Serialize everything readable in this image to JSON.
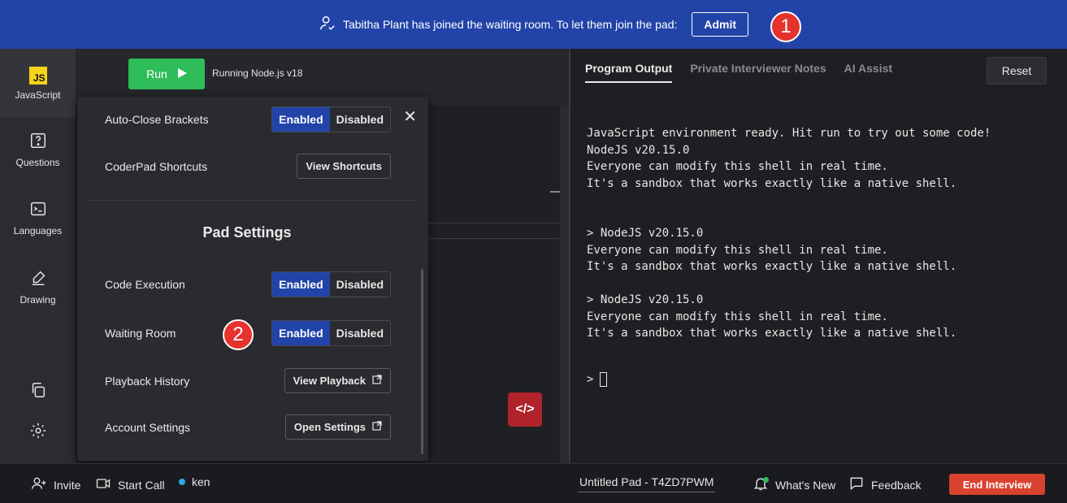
{
  "banner": {
    "message": "Tabitha Plant has joined the waiting room. To let them join the pad:",
    "admit_label": "Admit",
    "marker_1": "1"
  },
  "sidebar": {
    "items": [
      {
        "label": "JavaScript",
        "badge": "JS"
      },
      {
        "label": "Questions"
      },
      {
        "label": "Languages"
      },
      {
        "label": "Drawing"
      }
    ]
  },
  "editor": {
    "run_label": "Run",
    "run_status": "Running Node.js v18",
    "code_icon": "</>"
  },
  "settings": {
    "rows": [
      {
        "label": "Auto-Close Brackets",
        "on": "Enabled",
        "off": "Disabled"
      },
      {
        "label": "CoderPad Shortcuts",
        "button": "View Shortcuts"
      },
      {
        "label": "Code Execution",
        "on": "Enabled",
        "off": "Disabled"
      },
      {
        "label": "Waiting Room",
        "on": "Enabled",
        "off": "Disabled"
      },
      {
        "label": "Playback History",
        "button": "View Playback"
      },
      {
        "label": "Account Settings",
        "button": "Open Settings"
      }
    ],
    "section_title": "Pad Settings",
    "marker_2": "2",
    "close_glyph": "✕"
  },
  "output": {
    "tabs": [
      "Program Output",
      "Private Interviewer Notes",
      "AI Assist"
    ],
    "reset_label": "Reset",
    "console_text": "JavaScript environment ready. Hit run to try out some code!\nNodeJS v20.15.0\nEveryone can modify this shell in real time.\nIt's a sandbox that works exactly like a native shell.\n\n\n> NodeJS v20.15.0\nEveryone can modify this shell in real time.\nIt's a sandbox that works exactly like a native shell.\n\n> NodeJS v20.15.0\nEveryone can modify this shell in real time.\nIt's a sandbox that works exactly like a native shell.",
    "prompt": ">"
  },
  "bottom": {
    "invite": "Invite",
    "start_call": "Start Call",
    "user": "ken",
    "pad_name": "Untitled Pad - T4ZD7PWM",
    "whats_new": "What's New",
    "feedback": "Feedback",
    "end_interview": "End Interview"
  },
  "colors": {
    "banner": "#2244a8",
    "run": "#2ebd59",
    "end": "#d8422f",
    "marker": "#e5322d",
    "toggle_on": "#2244a8"
  }
}
